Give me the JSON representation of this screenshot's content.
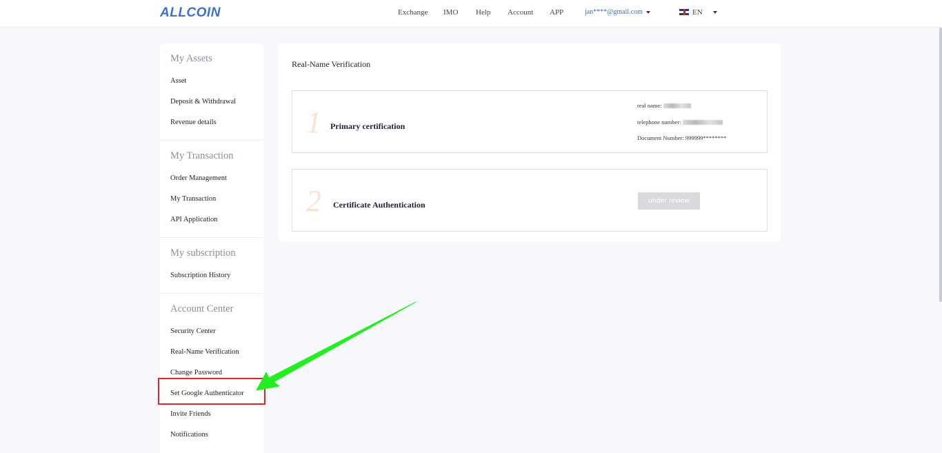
{
  "header": {
    "logo": "ALLCOIN",
    "nav": [
      {
        "label": "Exchange"
      },
      {
        "label": "IMO"
      },
      {
        "label": "Help"
      },
      {
        "label": "Account"
      },
      {
        "label": "APP"
      }
    ],
    "user_email": "jan****@gmail.com",
    "language": "EN"
  },
  "sidebar": {
    "groups": [
      {
        "title": "My Assets",
        "items": [
          "Asset",
          "Deposit & Withdrawal",
          "Revenue details"
        ]
      },
      {
        "title": "My Transaction",
        "items": [
          "Order Management",
          "My Transaction",
          "API Application"
        ]
      },
      {
        "title": "My subscription",
        "items": [
          "Subscription History"
        ]
      },
      {
        "title": "Account Center",
        "items": [
          "Security Center",
          "Real-Name Verification",
          "Change Password",
          "Set Google Authenticator",
          "Invite Friends",
          "Notifications"
        ]
      }
    ]
  },
  "main": {
    "title": "Real-Name Verification",
    "steps": [
      {
        "number": "1",
        "label": "Primary certification",
        "fields": {
          "real_name_label": "real name:",
          "telephone_label": "telephone number:",
          "document_label": "Document Number: 999999********"
        }
      },
      {
        "number": "2",
        "label": "Certificate Authentication",
        "status": "under review"
      }
    ]
  },
  "colors": {
    "brand": "#3b6fd8",
    "highlight": "#e02424",
    "arrow": "#22ee22",
    "step_number": "#fbe3d1",
    "status_button": "#d7d9dc"
  }
}
